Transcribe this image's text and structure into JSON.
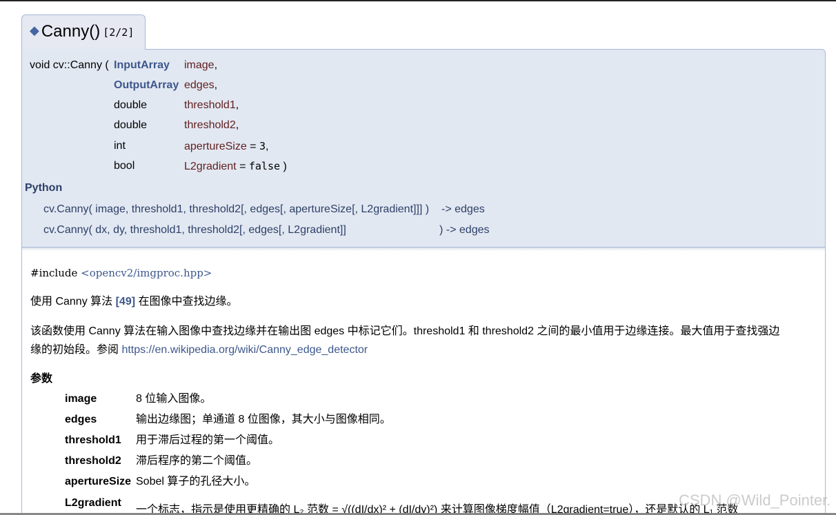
{
  "tab": {
    "diamond": "◆",
    "name": "Canny()",
    "overload": "[2/2]"
  },
  "proto": {
    "return_type": "void cv::Canny (",
    "params": [
      {
        "type": "InputArray",
        "name": "image",
        "suffix": ","
      },
      {
        "type": "OutputArray",
        "name": "edges",
        "suffix": ","
      },
      {
        "type": "double",
        "name": "threshold1",
        "suffix": ","
      },
      {
        "type": "double",
        "name": "threshold2",
        "suffix": ","
      },
      {
        "type": "int",
        "name": "apertureSize",
        "suffix": " = ",
        "default": "3",
        "tail": ","
      },
      {
        "type": "bool",
        "name": "L2gradient",
        "suffix": " = ",
        "default": "false",
        "tail": " )"
      }
    ],
    "python_heading": "Python",
    "python_lines": [
      {
        "call": "cv.Canny( image, threshold1, threshold2[, edges[, apertureSize[, L2gradient]]] )",
        "ret": " -> edges"
      },
      {
        "call": "cv.Canny( dx, dy, threshold1, threshold2[, edges[, L2gradient]]",
        "ret": ") -> edges"
      }
    ]
  },
  "doc": {
    "include_prefix": "#include ",
    "include_header": "<opencv2/imgproc.hpp>",
    "summary_pre": "使用 Canny 算法 ",
    "summary_cite": "[49]",
    "summary_post": " 在图像中查找边缘。",
    "desc_line1": "该函数使用 Canny 算法在输入图像中查找边缘并在输出图 edges 中标记它们。threshold1 和 threshold2 之间的最小值用于边缘连接。最大值用于查找强边",
    "desc_line2_pre": "缘的初始段。参阅 ",
    "desc_link": "https://en.wikipedia.org/wiki/Canny_edge_detector",
    "params_heading": "参数",
    "params": [
      {
        "name": "image",
        "desc": "8 位输入图像。"
      },
      {
        "name": "edges",
        "desc": "输出边缘图；单通道 8 位图像，其大小与图像相同。"
      },
      {
        "name": "threshold1",
        "desc": "用于滞后过程的第一个阈值。"
      },
      {
        "name": "threshold2",
        "desc": "滞后程序的第二个阈值。"
      },
      {
        "name": "apertureSize",
        "desc": "Sobel 算子的孔径大小。"
      },
      {
        "name": "L2gradient",
        "desc": "一个标志，指示是使用更精确的 L₂ 范数 = √((dI/dx)² + (dI/dy)²) 来计算图像梯度幅值（L2gradient=true），还是默认的 L₁ 范数"
      }
    ]
  },
  "watermark": "CSDN @Wild_Pointer."
}
